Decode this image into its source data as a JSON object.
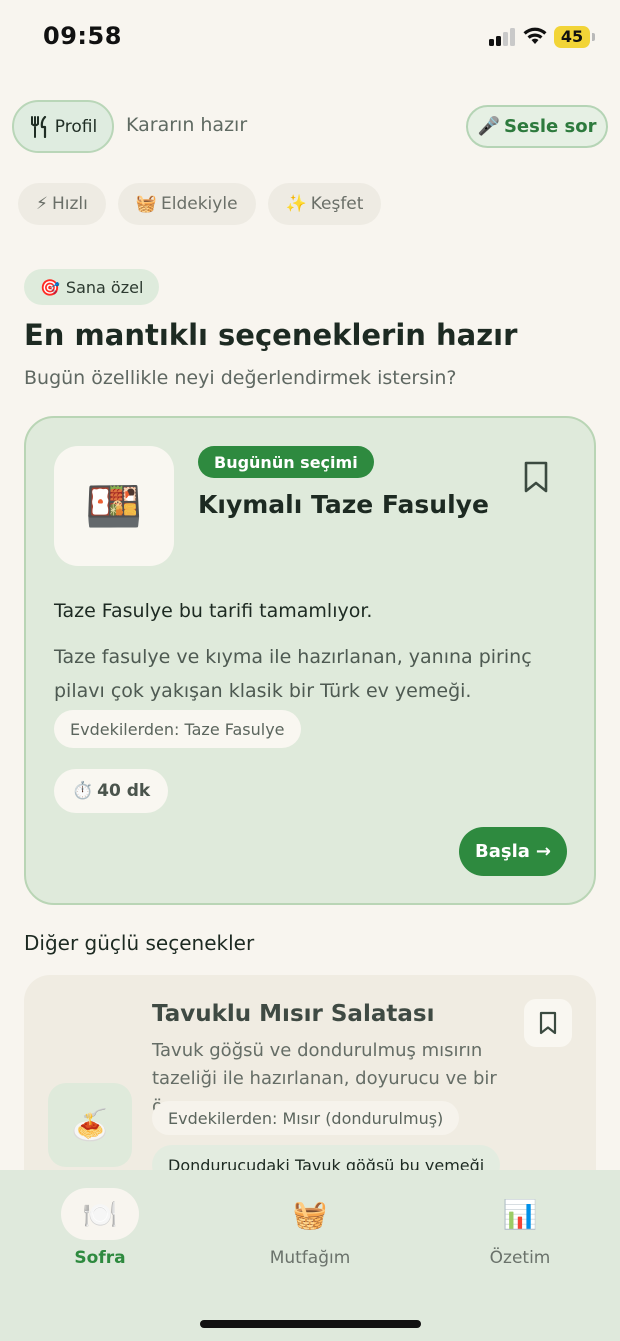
{
  "status_bar": {
    "time": "09:58",
    "battery": "45"
  },
  "header": {
    "profile_label": "Profil",
    "subtitle": "Kararın hazır",
    "voice_label": "Sesle sor"
  },
  "modes": [
    {
      "icon": "⚡",
      "label": "Hızlı"
    },
    {
      "icon": "🧺",
      "label": "Eldekiyle"
    },
    {
      "icon": "✨",
      "label": "Keşfet"
    }
  ],
  "personal_badge": {
    "icon": "🎯",
    "label": "Sana özel"
  },
  "headline": "En mantıklı seçeneklerin hazır",
  "subheadline": "Bugün özellikle neyi değerlendirmek istersin?",
  "hero": {
    "emoji": "🍱",
    "badge": "Bugünün seçimi",
    "title": "Kıymalı Taze Fasulye",
    "reason": "Taze Fasulye bu tarifi tamamlıyor.",
    "description": "Taze fasulye ve kıyma ile hazırlanan, yanına pirinç pilavı çok yakışan klasik bir Türk ev yemeği.",
    "pantry": "Evdekilerden: Taze Fasulye",
    "time_icon": "⏱️",
    "time": "40 dk",
    "start_label": "Başla",
    "start_arrow": "→"
  },
  "section_title": "Diğer güçlü seçenekler",
  "alternatives": [
    {
      "emoji": "🍝",
      "title": "Tavuklu Mısır Salatası",
      "description": "Tavuk göğsü ve dondurulmuş mısırın tazeliği ile hazırlanan, doyurucu ve bir ö…",
      "pantry": "Evdekilerden: Mısır (dondurulmuş)",
      "reason": "Dondurucudaki Tavuk göğsü bu yemeği"
    }
  ],
  "tabs": [
    {
      "icon": "🍽️",
      "label": "Sofra",
      "active": true
    },
    {
      "icon": "🧺",
      "label": "Mutfağım",
      "active": false
    },
    {
      "icon": "📊",
      "label": "Özetim",
      "active": false
    }
  ],
  "colors": {
    "accent": "#2e8a3f",
    "card_green": "#dfeadb",
    "background": "#f8f5ef"
  }
}
